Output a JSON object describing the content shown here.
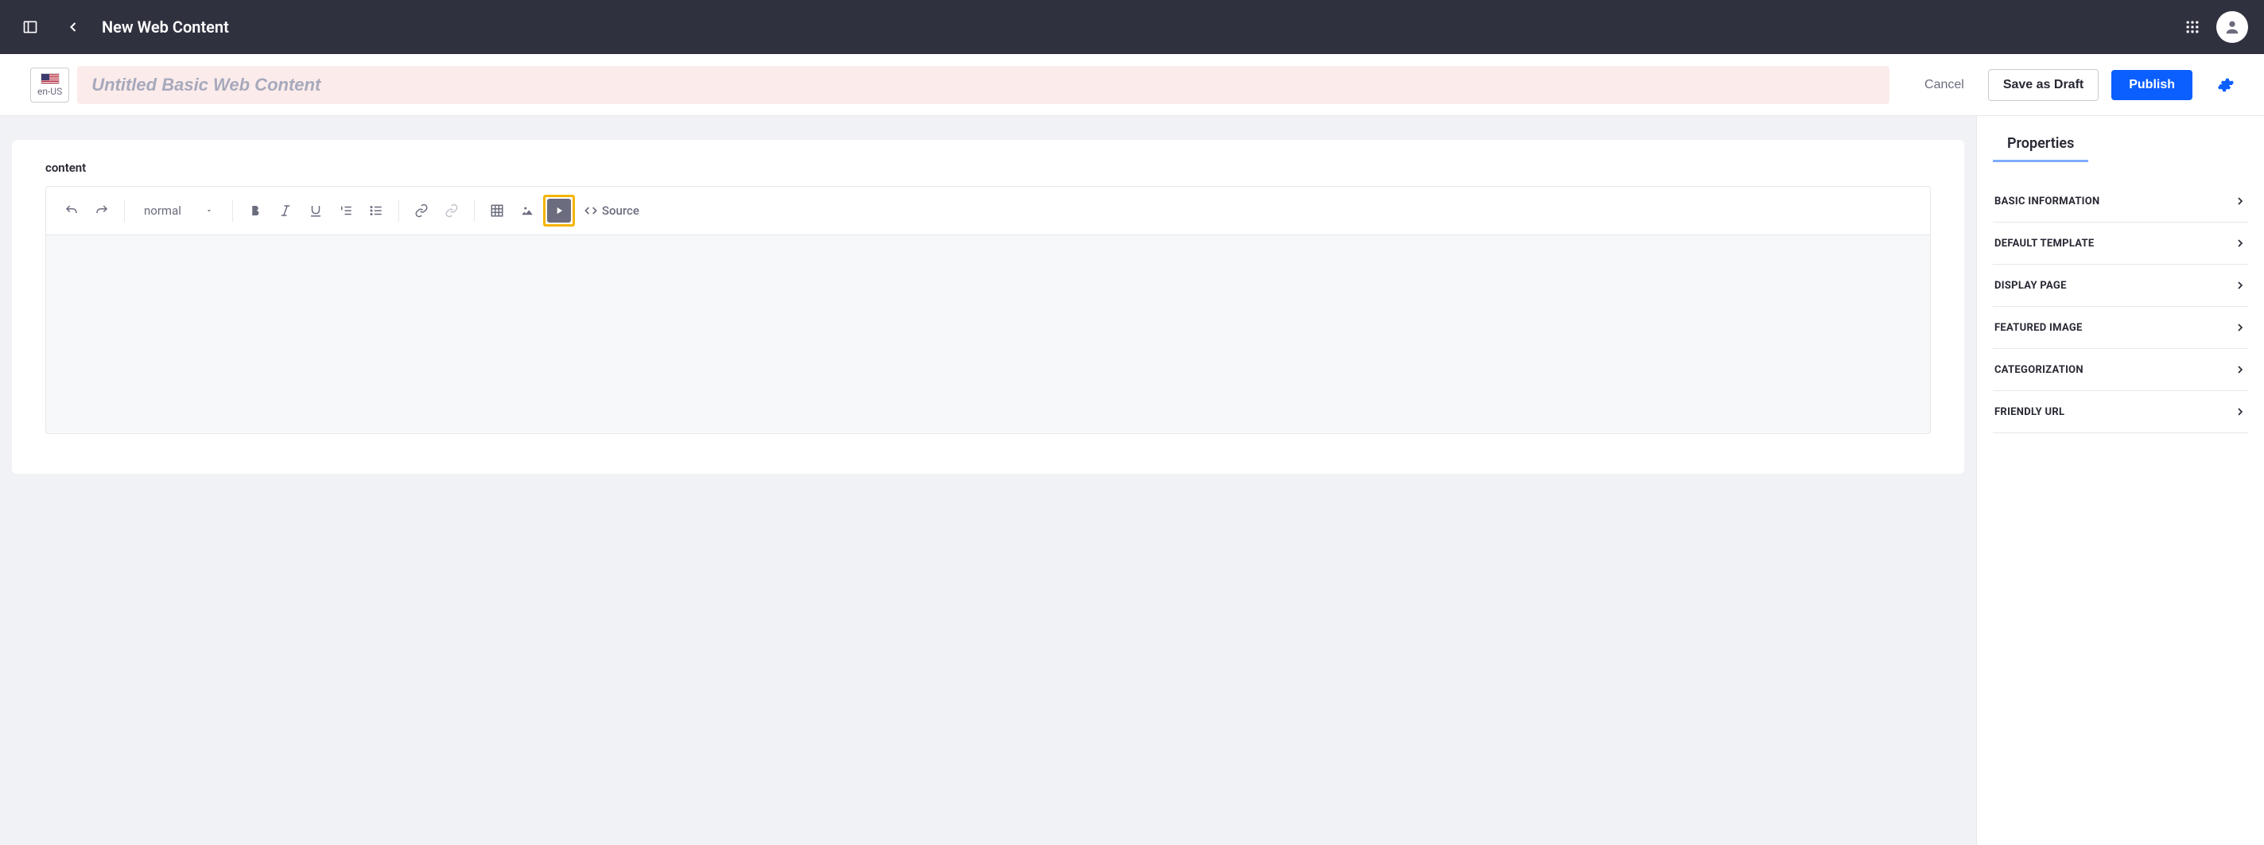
{
  "header": {
    "title": "New Web Content"
  },
  "locale": {
    "code": "en-US"
  },
  "titleField": {
    "placeholder": "Untitled Basic Web Content",
    "value": ""
  },
  "actions": {
    "cancel": "Cancel",
    "saveDraft": "Save as Draft",
    "publish": "Publish"
  },
  "editor": {
    "fieldLabel": "content",
    "styleSelected": "normal",
    "sourceLabel": "Source"
  },
  "propertiesPanel": {
    "tabLabel": "Properties",
    "sections": [
      {
        "label": "BASIC INFORMATION"
      },
      {
        "label": "DEFAULT TEMPLATE"
      },
      {
        "label": "DISPLAY PAGE"
      },
      {
        "label": "FEATURED IMAGE"
      },
      {
        "label": "CATEGORIZATION"
      },
      {
        "label": "FRIENDLY URL"
      }
    ]
  },
  "colors": {
    "primary": "#0b5fff",
    "topbar": "#30313f",
    "highlight": "#f5b400"
  }
}
